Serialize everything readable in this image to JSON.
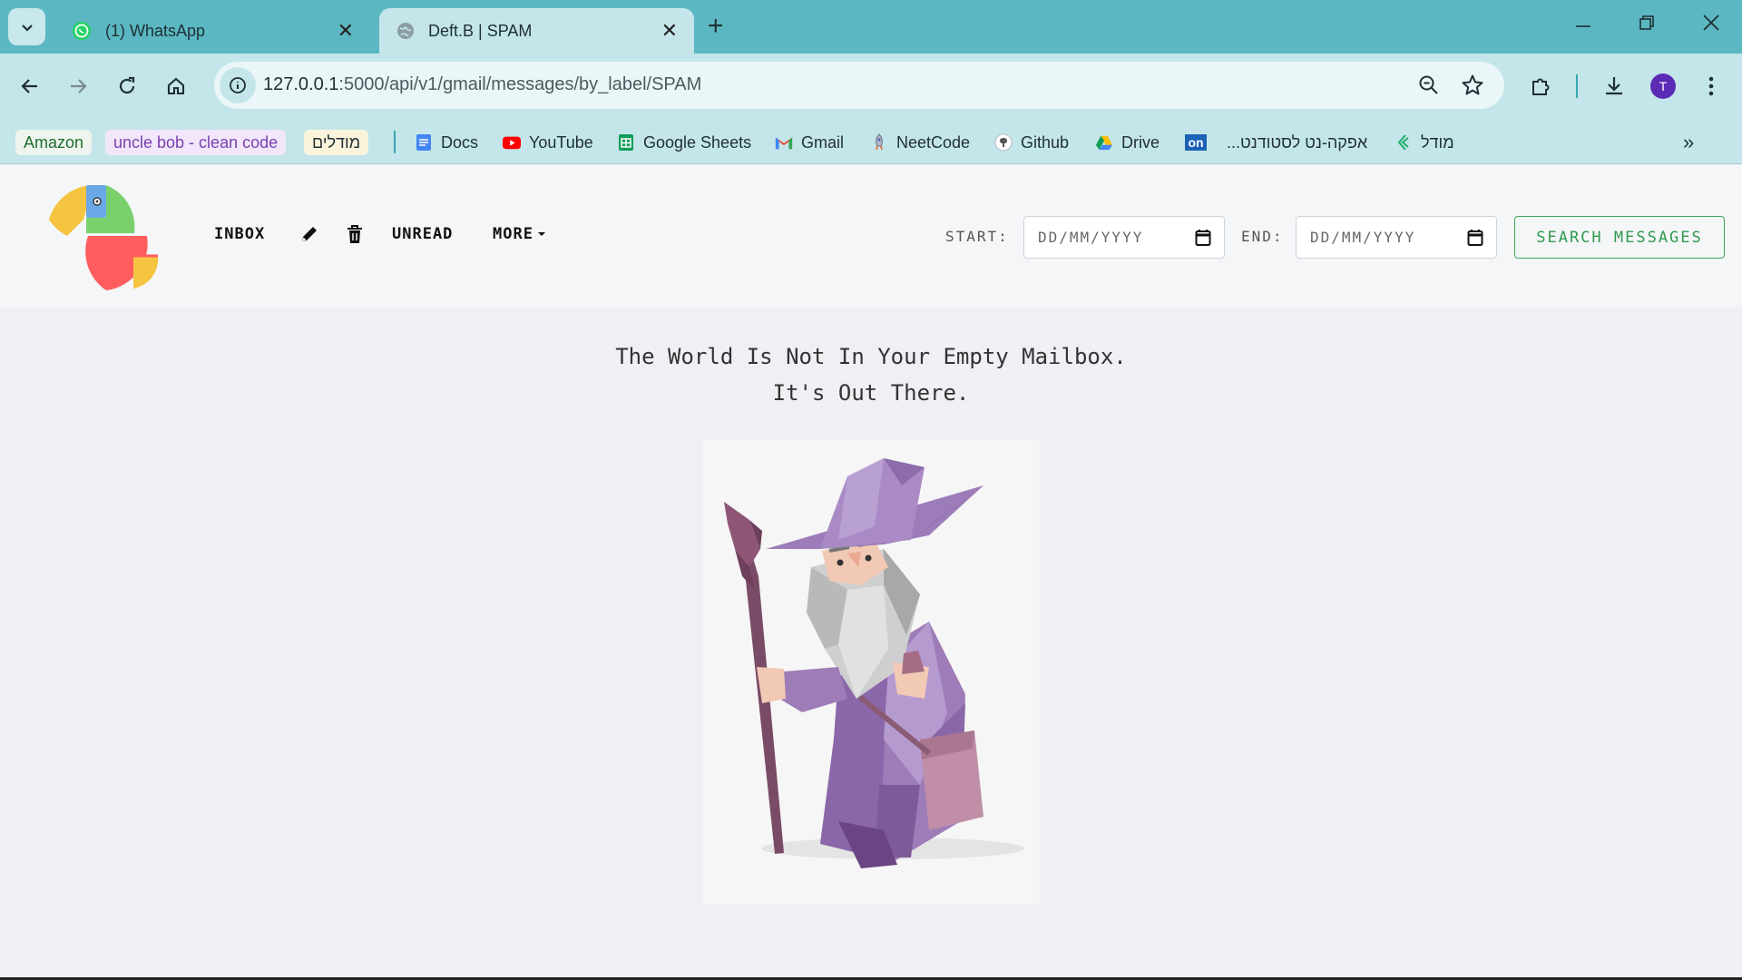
{
  "browser": {
    "tabs": [
      {
        "title": "(1) WhatsApp",
        "icon": "whatsapp-icon",
        "active": false
      },
      {
        "title": "Deft.B | SPAM",
        "icon": "globe-icon",
        "active": true
      }
    ],
    "url_host": "127.0.0.1",
    "url_rest": ":5000/api/v1/gmail/messages/by_label/SPAM",
    "profile_initial": "T",
    "bookmarks": [
      {
        "label": "Amazon",
        "icon": "",
        "pill_bg": "#eef4ee",
        "color": "#1f6f2f"
      },
      {
        "label": "uncle bob - clean code",
        "icon": "",
        "pill_bg": "#f1e6fa",
        "color": "#7b3fb0"
      },
      {
        "label": "מודלים",
        "icon": "",
        "pill_bg": "#fbf4dc",
        "color": "#1f2f33"
      },
      {
        "label": "Docs",
        "icon": "docs-icon"
      },
      {
        "label": "YouTube",
        "icon": "youtube-icon"
      },
      {
        "label": "Google Sheets",
        "icon": "sheets-icon"
      },
      {
        "label": "Gmail",
        "icon": "gmail-icon"
      },
      {
        "label": "NeetCode",
        "icon": "rocket-icon"
      },
      {
        "label": "Github",
        "icon": "github-icon"
      },
      {
        "label": "Drive",
        "icon": "drive-icon"
      },
      {
        "label": "",
        "icon": "on-icon"
      },
      {
        "label": "אפקה-נט לסטודנט...",
        "icon": ""
      },
      {
        "label": "מודל",
        "icon": "moodle-icon"
      }
    ]
  },
  "header": {
    "nav": {
      "inbox": "INBOX",
      "unread": "UNREAD",
      "more": "MORE"
    },
    "start_label": "START:",
    "end_label": "END:",
    "date_placeholder": "DD/MM/YYYY",
    "search_button": "SEARCH MESSAGES"
  },
  "main": {
    "empty_line_1": "The World Is Not In Your Empty Mailbox.",
    "empty_line_2": "It's Out There."
  },
  "colors": {
    "tabbar": "#5bb8c2",
    "toolbar": "#c4e6ea",
    "accent_green": "#2f9a4e",
    "page_bg": "#eef0f4"
  }
}
